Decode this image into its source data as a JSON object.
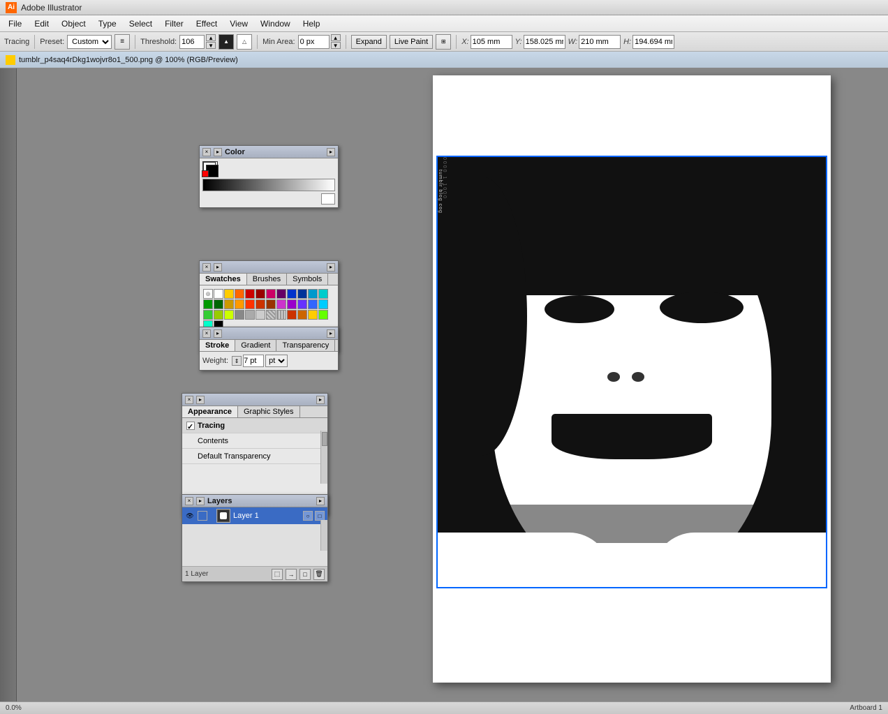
{
  "app": {
    "title": "Adobe Illustrator",
    "icon_text": "Ai"
  },
  "menu": {
    "items": [
      "File",
      "Edit",
      "Object",
      "Type",
      "Select",
      "Filter",
      "Effect",
      "View",
      "Window",
      "Help"
    ]
  },
  "toolbar": {
    "tracing_label": "Tracing",
    "preset_label": "Preset:",
    "preset_value": "Custom",
    "threshold_label": "Threshold:",
    "threshold_value": "106",
    "min_area_label": "Min Area:",
    "min_area_value": "0 px",
    "expand_label": "Expand",
    "live_paint_label": "Live Paint",
    "x_label": "X:",
    "x_value": "105 mm",
    "y_label": "Y:",
    "y_value": "158.025 mm",
    "w_label": "W:",
    "w_value": "210 mm",
    "h_label": "H:",
    "h_value": "194.694 mm"
  },
  "doc_tab": {
    "title": "tumblr_p4saq4rDkg1wojvr8o1_500.png @ 100% (RGB/Preview)"
  },
  "panels": {
    "color": {
      "title": "Color",
      "tabs": [
        "Color"
      ]
    },
    "swatches": {
      "tabs": [
        "Swatches",
        "Brushes",
        "Symbols"
      ]
    },
    "stroke": {
      "tabs": [
        "Stroke",
        "Gradient",
        "Transparency"
      ],
      "weight_label": "Weight:",
      "weight_value": "7 pt"
    },
    "appearance": {
      "tabs": [
        "Appearance",
        "Graphic Styles"
      ],
      "items": [
        {
          "name": "Tracing",
          "selected": true,
          "has_checkbox": true
        },
        {
          "name": "Contents",
          "selected": false
        },
        {
          "name": "Default Transparency",
          "selected": false
        }
      ]
    },
    "layers": {
      "title": "Layers",
      "label": "1 Layer",
      "layer_name": "Layer 1"
    }
  },
  "status_bar": {
    "zoom": "0.0%",
    "artboard": "Artboard 1"
  },
  "colors": {
    "accent_blue": "#316ac5",
    "panel_bg": "#e8e8e8",
    "toolbar_bg": "#dcdcdc"
  }
}
